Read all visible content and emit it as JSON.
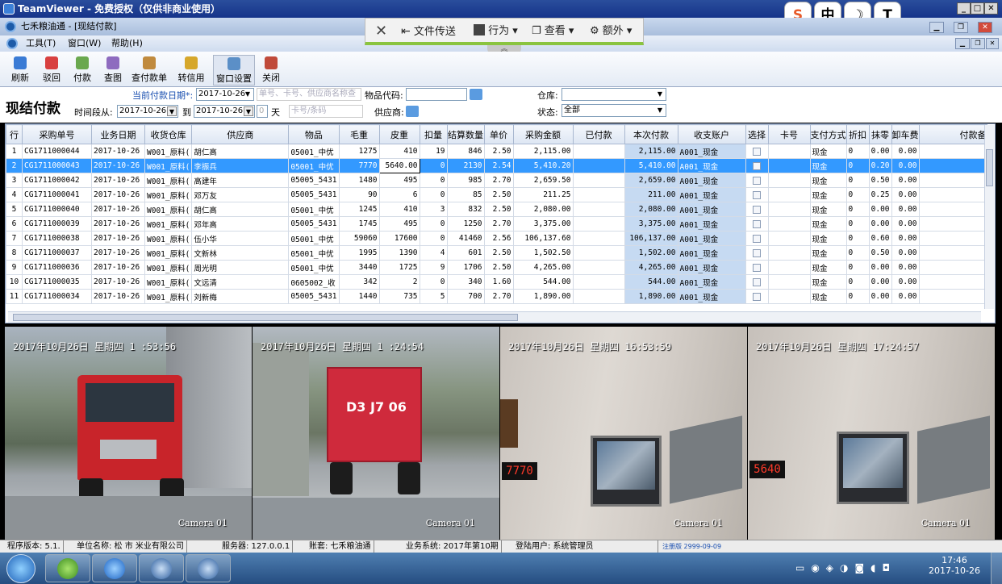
{
  "teamviewer": {
    "title": "TeamViewer - 免费授权（仅供非商业使用）",
    "toolbar": [
      {
        "icon": "close-icon",
        "label": ""
      },
      {
        "icon": "file-transfer-icon",
        "label": "文件传送"
      },
      {
        "icon": "action-icon",
        "label": "行为 ▾"
      },
      {
        "icon": "view-icon",
        "label": "查看 ▾"
      },
      {
        "icon": "gear-icon",
        "label": "额外 ▾"
      }
    ],
    "collapse_glyph": "︽",
    "widgets": [
      "S",
      "中",
      "☽",
      "T"
    ]
  },
  "app": {
    "title": "七禾粮油通 - [现结付款]",
    "menu": [
      "工具(T)",
      "窗口(W)",
      "帮助(H)"
    ]
  },
  "toolbar": [
    {
      "label": "刷新",
      "icon": "refresh-icon",
      "color": "#3a7bd5"
    },
    {
      "label": "驳回",
      "icon": "reject-icon",
      "color": "#d84040"
    },
    {
      "label": "付款",
      "icon": "pay-icon",
      "color": "#6aa84f"
    },
    {
      "label": "查图",
      "icon": "image-icon",
      "color": "#8e6bbf"
    },
    {
      "label": "查付款单",
      "icon": "search-payment-icon",
      "color": "#c08a3e"
    },
    {
      "label": "转信用",
      "icon": "credit-icon",
      "color": "#d6a72b"
    },
    {
      "label": "窗口设置",
      "icon": "window-settings-icon",
      "color": "#5b8fc7"
    },
    {
      "label": "关闭",
      "icon": "exit-icon",
      "color": "#c04a3a"
    }
  ],
  "filter": {
    "page_title": "现结付款",
    "date_label": "当前付款日期*:",
    "date_value": "2017-10-26",
    "search_placeholder": "单号、卡号、供应商名称查",
    "product_code_label": "物品代码:",
    "warehouse_label": "仓库:",
    "range_label": "时间段从:",
    "range_from": "2017-10-26",
    "range_to_label": "到",
    "range_to": "2017-10-26",
    "days_value": "0",
    "days_label": "天",
    "card_placeholder": "卡号/条码",
    "supplier_label": "供应商:",
    "status_label": "状态:",
    "status_value": "全部"
  },
  "grid": {
    "columns": [
      "行",
      "采购单号",
      "业务日期",
      "收货仓库",
      "供应商",
      "物品",
      "毛重",
      "皮重",
      "扣量",
      "结算数量",
      "单价",
      "采购金额",
      "已付款",
      "本次付款",
      "收支账户",
      "选择",
      "卡号",
      "支付方式",
      "折扣",
      "抹零",
      "卸车费",
      "付款备"
    ],
    "rows": [
      [
        "1",
        "CG1711000044",
        "2017-10-26",
        "W001_原料(",
        "胡仁高",
        "05001_中优",
        "1275",
        "410",
        "19",
        "846",
        "2.50",
        "2,115.00",
        "",
        "2,115.00",
        "A001_现金",
        "",
        "",
        "现金",
        "0",
        "0.00",
        "0.00",
        ""
      ],
      [
        "2",
        "CG1711000043",
        "2017-10-26",
        "W001_原料(",
        "李振兵",
        "05001_中优",
        "7770",
        "5640.00",
        "0",
        "2130",
        "2.54",
        "5,410.20",
        "",
        "5,410.00",
        "A001_现金",
        "",
        "",
        "现金",
        "0",
        "0.20",
        "0.00",
        ""
      ],
      [
        "3",
        "CG1711000042",
        "2017-10-26",
        "W001_原料(",
        "高建年",
        "05005_5431",
        "1480",
        "495",
        "0",
        "985",
        "2.70",
        "2,659.50",
        "",
        "2,659.00",
        "A001_现金",
        "",
        "",
        "现金",
        "0",
        "0.50",
        "0.00",
        ""
      ],
      [
        "4",
        "CG1711000041",
        "2017-10-26",
        "W001_原料(",
        "邓万友",
        "05005_5431",
        "90",
        "6",
        "0",
        "85",
        "2.50",
        "211.25",
        "",
        "211.00",
        "A001_现金",
        "",
        "",
        "现金",
        "0",
        "0.25",
        "0.00",
        ""
      ],
      [
        "5",
        "CG1711000040",
        "2017-10-26",
        "W001_原料(",
        "胡仁高",
        "05001_中优",
        "1245",
        "410",
        "3",
        "832",
        "2.50",
        "2,080.00",
        "",
        "2,080.00",
        "A001_现金",
        "",
        "",
        "现金",
        "0",
        "0.00",
        "0.00",
        ""
      ],
      [
        "6",
        "CG1711000039",
        "2017-10-26",
        "W001_原料(",
        "邓年高",
        "05005_5431",
        "1745",
        "495",
        "0",
        "1250",
        "2.70",
        "3,375.00",
        "",
        "3,375.00",
        "A001_现金",
        "",
        "",
        "现金",
        "0",
        "0.00",
        "0.00",
        ""
      ],
      [
        "7",
        "CG1711000038",
        "2017-10-26",
        "W001_原料(",
        "伍小华",
        "05001_中优",
        "59060",
        "17600",
        "0",
        "41460",
        "2.56",
        "106,137.60",
        "",
        "106,137.00",
        "A001_现金",
        "",
        "",
        "现金",
        "0",
        "0.60",
        "0.00",
        ""
      ],
      [
        "8",
        "CG1711000037",
        "2017-10-26",
        "W001_原料(",
        "文新林",
        "05001_中优",
        "1995",
        "1390",
        "4",
        "601",
        "2.50",
        "1,502.50",
        "",
        "1,502.00",
        "A001_现金",
        "",
        "",
        "现金",
        "0",
        "0.50",
        "0.00",
        ""
      ],
      [
        "9",
        "CG1711000036",
        "2017-10-26",
        "W001_原料(",
        "周光明",
        "05001_中优",
        "3440",
        "1725",
        "9",
        "1706",
        "2.50",
        "4,265.00",
        "",
        "4,265.00",
        "A001_现金",
        "",
        "",
        "现金",
        "0",
        "0.00",
        "0.00",
        ""
      ],
      [
        "10",
        "CG1711000035",
        "2017-10-26",
        "W001_原料(",
        "文远清",
        "0605002_收",
        "342",
        "2",
        "0",
        "340",
        "1.60",
        "544.00",
        "",
        "544.00",
        "A001_现金",
        "",
        "",
        "现金",
        "0",
        "0.00",
        "0.00",
        ""
      ],
      [
        "11",
        "CG1711000034",
        "2017-10-26",
        "W001_原料(",
        "刘新梅",
        "05005_5431",
        "1440",
        "735",
        "5",
        "700",
        "2.70",
        "1,890.00",
        "",
        "1,890.00",
        "A001_现金",
        "",
        "",
        "现金",
        "0",
        "0.00",
        "0.00",
        ""
      ]
    ],
    "selected_row": 1
  },
  "cameras": [
    {
      "timestamp": "2017年10月26日 星期四 1 :53:56",
      "label": "Camera 01",
      "scene": "truck-front"
    },
    {
      "timestamp": "2017年10月26日 星期四 1 :24:54",
      "label": "Camera 01",
      "scene": "truck-back",
      "plate": "D3 J7 06"
    },
    {
      "timestamp": "2017年10月26日 星期四 16:53:59",
      "label": "Camera 01",
      "scene": "scale-display",
      "display": "7770"
    },
    {
      "timestamp": "2017年10月26日 星期四 17:24:57",
      "label": "Camera 01",
      "scene": "scale-display",
      "display": "5640"
    }
  ],
  "status": {
    "version": "程序版本: 5.1.",
    "company": "单位名称: 松  市  米业有限公司",
    "server": "服务器: 127.0.0.1",
    "account": "账套: 七禾粮油通",
    "business": "业务系统: 2017年第10期",
    "user": "登陆用户: 系统管理员",
    "registered": "注册版 2999-09-09"
  },
  "taskbar": {
    "time": "17:46",
    "date": "2017-10-26"
  }
}
